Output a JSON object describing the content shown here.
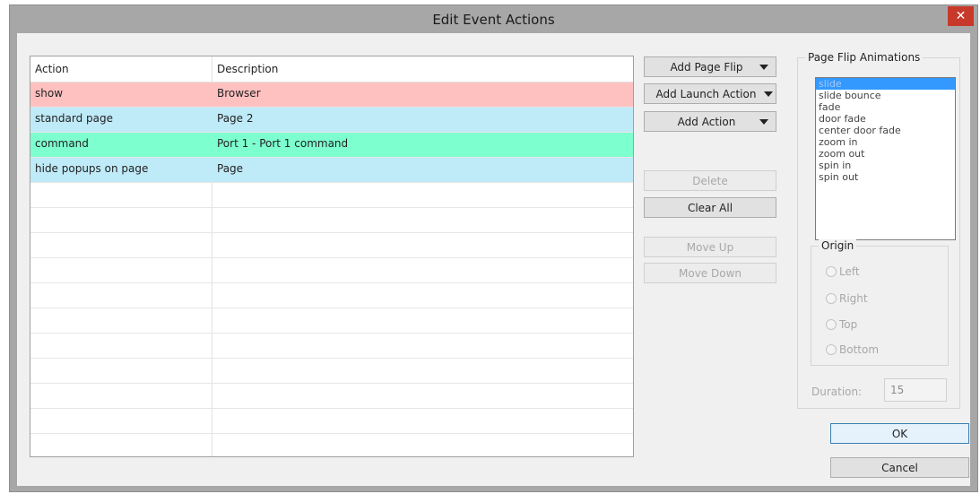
{
  "window": {
    "title": "Edit Event Actions",
    "close_glyph": "✕"
  },
  "grid": {
    "columns": [
      "Action",
      "Description"
    ],
    "rows": [
      {
        "action": "show",
        "description": "Browser",
        "color": "#ffc0c0"
      },
      {
        "action": "standard page",
        "description": "Page 2",
        "color": "#bfeaf8"
      },
      {
        "action": "command",
        "description": "Port 1 - Port 1 command",
        "color": "#7dffd0"
      },
      {
        "action": "hide popups on page",
        "description": "Page",
        "color": "#bfeaf8"
      }
    ],
    "empty_rows": 11
  },
  "buttons": {
    "add_page_flip": "Add Page Flip",
    "add_launch_action": "Add Launch Action",
    "add_action": "Add Action",
    "delete": "Delete",
    "clear_all": "Clear All",
    "move_up": "Move Up",
    "move_down": "Move Down",
    "ok": "OK",
    "cancel": "Cancel"
  },
  "animations": {
    "legend": "Page Flip Animations",
    "items": [
      "slide",
      "slide bounce",
      "fade",
      "door fade",
      "center door fade",
      "zoom in",
      "zoom out",
      "spin in",
      "spin out"
    ],
    "selected": "slide"
  },
  "origin": {
    "legend": "Origin",
    "options": [
      "Left",
      "Right",
      "Top",
      "Bottom"
    ]
  },
  "duration": {
    "label": "Duration:",
    "value": "15"
  }
}
